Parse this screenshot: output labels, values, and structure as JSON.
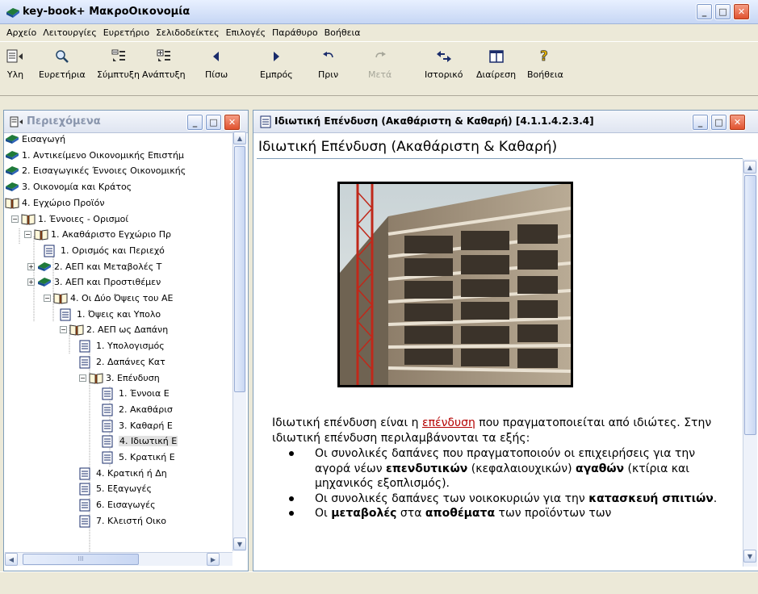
{
  "window": {
    "title": "key-book+  ΜακροΟικονομία"
  },
  "menu": [
    "Αρχείο",
    "Λειτουργίες",
    "Ευρετήριο",
    "Σελιδοδείκτες",
    "Επιλογές",
    "Παράθυρο",
    "Βοήθεια"
  ],
  "toolbar": [
    {
      "label": "Υλη",
      "icon": "contents-icon"
    },
    {
      "label": "Ευρετήρια",
      "icon": "search-icon"
    },
    {
      "label": "Σύμπτυξη",
      "icon": "collapse-icon"
    },
    {
      "label": "Ανάπτυξη",
      "icon": "expand-icon"
    },
    {
      "label": "Πίσω",
      "icon": "back-arrow-icon"
    },
    {
      "label": "Εμπρός",
      "icon": "forward-arrow-icon"
    },
    {
      "label": "Πριν",
      "icon": "undo-icon"
    },
    {
      "label": "Μετά",
      "icon": "redo-icon",
      "disabled": true
    },
    {
      "label": "Ιστορικό",
      "icon": "history-icon"
    },
    {
      "label": "Διαίρεση",
      "icon": "split-icon"
    },
    {
      "label": "Βοήθεια",
      "icon": "help-icon"
    }
  ],
  "contents_pane": {
    "title": "Περιεχόμενα",
    "items": [
      {
        "label": "Εισαγωγή",
        "icon": "book-closed"
      },
      {
        "label": "1. Αντικείμενο Οικονομικής Επιστήμ",
        "icon": "book-closed"
      },
      {
        "label": "2. Εισαγωγικές Έννοιες Οικονομικής",
        "icon": "book-closed"
      },
      {
        "label": "3. Οικονομία και Κράτος",
        "icon": "book-closed"
      },
      {
        "label": "4. Εγχώριο Προϊόν",
        "icon": "book-open"
      },
      {
        "label": "1. Έννοιες - Ορισμοί",
        "icon": "book-open",
        "expander": "−"
      },
      {
        "label": "1. Ακαθάριστο Εγχώριο Πρ",
        "icon": "book-open",
        "expander": "−"
      },
      {
        "label": "1. Ορισμός και Περιεχό",
        "icon": "page"
      },
      {
        "label": "2. ΑΕΠ και Μεταβολές Τ",
        "icon": "book-closed",
        "expander": "+"
      },
      {
        "label": "3. ΑΕΠ και Προστιθέμεν",
        "icon": "book-closed",
        "expander": "+"
      },
      {
        "label": "4. Οι Δύο Όψεις του ΑΕ",
        "icon": "book-open",
        "expander": "−"
      },
      {
        "label": "1. Όψεις και Υπολο",
        "icon": "page"
      },
      {
        "label": "2. ΑΕΠ ως Δαπάνη",
        "icon": "book-open",
        "expander": "−"
      },
      {
        "label": "1. Υπολογισμός",
        "icon": "page"
      },
      {
        "label": "2. Δαπάνες Κατ",
        "icon": "page"
      },
      {
        "label": "3. Επένδυση",
        "icon": "book-open",
        "expander": "−"
      },
      {
        "label": "1. Έννοια Ε",
        "icon": "page"
      },
      {
        "label": "2. Ακαθάρισ",
        "icon": "page"
      },
      {
        "label": "3. Καθαρή Ε",
        "icon": "page"
      },
      {
        "label": "4. Ιδιωτική Ε",
        "icon": "page",
        "selected": true
      },
      {
        "label": "5. Κρατική Ε",
        "icon": "page"
      },
      {
        "label": "4. Κρατική ή Δη",
        "icon": "page"
      },
      {
        "label": "5. Εξαγωγές",
        "icon": "page"
      },
      {
        "label": "6. Εισαγωγές",
        "icon": "page"
      },
      {
        "label": "7. Κλειστή Οικο",
        "icon": "page"
      }
    ],
    "hscroll_mark": "III"
  },
  "document_pane": {
    "title": "Ιδιωτική Επένδυση (Ακαθάριστη & Καθαρή)   [4.1.1.4.2.3.4]",
    "heading": "Ιδιωτική Επένδυση (Ακαθάριστη & Καθαρή)",
    "photo_desc": "construction-building-photo",
    "para_before_link": "Ιδιωτική επένδυση είναι η ",
    "link": "επένδυση",
    "para_after_link": " που πραγματοποιείται από ιδιώτες. Στην ιδιωτική επένδυση περιλαμβάνονται τα εξής:",
    "bullet1_a": "Οι συνολικές δαπάνες που πραγματοποιούν οι επιχειρήσεις για την αγορά νέων ",
    "bullet1_b1": "επενδυτικών",
    "bullet1_c": " (κεφαλαιουχικών) ",
    "bullet1_b2": "αγαθών",
    "bullet1_d": " (κτίρια και μηχανικός εξοπλισμός).",
    "bullet2_a": "Οι συνολικές δαπάνες των νοικοκυριών για την ",
    "bullet2_b": "κατασκευή σπιτιών",
    "bullet2_c": ".",
    "bullet3_a": "Οι ",
    "bullet3_b1": "μεταβολές",
    "bullet3_c": " στα ",
    "bullet3_b2": "αποθέματα",
    "bullet3_d": " των προϊόντων των"
  },
  "colors": {
    "link": "#b40000",
    "close_button": "#df4e2a"
  }
}
